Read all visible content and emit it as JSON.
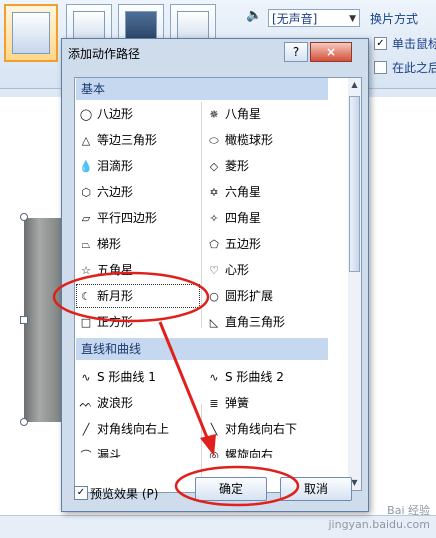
{
  "ribbon": {
    "sound_value": "[无声音]",
    "section_label": "换片方式",
    "check1_label": "单击鼠标",
    "check1_mark": "✓",
    "check2_label": "在此之后"
  },
  "dialog": {
    "title": "添加动作路径",
    "help_label": "?",
    "close_label": "×"
  },
  "groups": [
    {
      "header": "基本"
    },
    {
      "header": "直线和曲线"
    }
  ],
  "basic_items": [
    {
      "icon": "◯",
      "label": "八边形"
    },
    {
      "icon": "✵",
      "label": "八角星"
    },
    {
      "icon": "△",
      "label": "等边三角形"
    },
    {
      "icon": "⬭",
      "label": "橄榄球形"
    },
    {
      "icon": "💧",
      "label": "泪滴形"
    },
    {
      "icon": "◇",
      "label": "菱形"
    },
    {
      "icon": "⬡",
      "label": "六边形"
    },
    {
      "icon": "✡",
      "label": "六角星"
    },
    {
      "icon": "▱",
      "label": "平行四边形"
    },
    {
      "icon": "✧",
      "label": "四角星"
    },
    {
      "icon": "⏢",
      "label": "梯形"
    },
    {
      "icon": "⬠",
      "label": "五边形"
    },
    {
      "icon": "☆",
      "label": "五角星"
    },
    {
      "icon": "♡",
      "label": "心形"
    },
    {
      "icon": "☾",
      "label": "新月形"
    },
    {
      "icon": "○",
      "label": "圆形扩展"
    },
    {
      "icon": "□",
      "label": "正方形"
    },
    {
      "icon": "◺",
      "label": "直角三角形"
    }
  ],
  "line_items": [
    {
      "icon": "∿",
      "label": "S 形曲线 1"
    },
    {
      "icon": "∿",
      "label": "S 形曲线 2"
    },
    {
      "icon": "ᨓ",
      "label": "波浪形"
    },
    {
      "icon": "≣",
      "label": "弹簧"
    },
    {
      "icon": "╱",
      "label": "对角线向右上"
    },
    {
      "icon": "╲",
      "label": "对角线向右下"
    },
    {
      "icon": "⌒",
      "label": "漏斗"
    },
    {
      "icon": "◎",
      "label": "螺旋向右"
    }
  ],
  "footer": {
    "preview_label": "预览效果 (P)",
    "preview_checked": "✓",
    "ok_label": "确定",
    "cancel_label": "取消"
  },
  "watermark": {
    "line1": "Bai 经验",
    "line2": "jingyan.baidu.com"
  },
  "colors": {
    "annotation": "#e0201c",
    "header_bg": "#c6d8ef",
    "dialog_bg": "#cfdcec"
  }
}
